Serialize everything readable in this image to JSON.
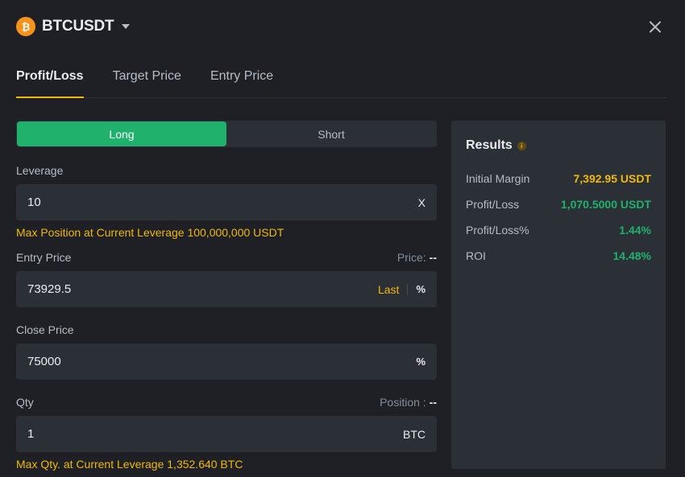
{
  "header": {
    "coin_glyph": "₿",
    "symbol": "BTCUSDT"
  },
  "tabs": [
    {
      "label": "Profit/Loss",
      "active": true
    },
    {
      "label": "Target Price",
      "active": false
    },
    {
      "label": "Entry Price",
      "active": false
    }
  ],
  "side": {
    "long_label": "Long",
    "short_label": "Short",
    "selected": "Long"
  },
  "leverage": {
    "label": "Leverage",
    "value": "10",
    "suffix": "X",
    "note": "Max Position at Current Leverage 100,000,000 USDT"
  },
  "entry_price": {
    "label": "Entry Price",
    "price_label": "Price:",
    "price_value": "--",
    "value": "73929.5",
    "last_label": "Last",
    "percent_glyph": "%"
  },
  "close_price": {
    "label": "Close Price",
    "value": "75000",
    "percent_glyph": "%"
  },
  "qty": {
    "label": "Qty",
    "position_label": "Position :",
    "position_value": "--",
    "value": "1",
    "suffix": "BTC",
    "note": "Max Qty. at Current Leverage 1,352.640 BTC"
  },
  "results": {
    "title": "Results",
    "rows": [
      {
        "label": "Initial Margin",
        "value": "7,392.95 USDT",
        "color": "#f0b90b"
      },
      {
        "label": "Profit/Loss",
        "value": "1,070.5000 USDT",
        "color": "#20b26c"
      },
      {
        "label": "Profit/Loss%",
        "value": "1.44%",
        "color": "#20b26c"
      },
      {
        "label": "ROI",
        "value": "14.48%",
        "color": "#20b26c"
      }
    ]
  },
  "colors": {
    "accent": "#f0b90b",
    "long_green": "#20b26c",
    "background": "#1e2026",
    "panel": "#2b2f36"
  }
}
